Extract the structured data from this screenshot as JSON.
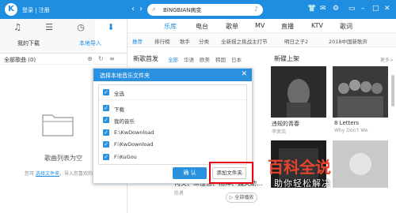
{
  "topbar": {
    "login": "登录 | 注册",
    "search_text": "BINGBIAN病变"
  },
  "left": {
    "tab_download": "我的下载",
    "tab_local_import": "本地导入",
    "section_title": "全部歌曲 (0)",
    "empty_title": "歌曲列表为空",
    "hint_prefix": "您可",
    "hint_link": "选择文件夹",
    "hint_suffix": "，导入您喜欢的音乐"
  },
  "main": {
    "tabs": [
      {
        "label": "乐库",
        "active": true
      },
      {
        "label": "电台"
      },
      {
        "label": "歌单"
      },
      {
        "label": "MV"
      },
      {
        "label": "直播"
      },
      {
        "label": "KTV"
      },
      {
        "label": "歌词"
      }
    ],
    "subtabs": [
      "推荐",
      "排行榜",
      "歌手",
      "分类",
      "全新摇之挑战主打节",
      "明日之子2",
      "2018中国新歌声"
    ],
    "new_first": "新歌首发",
    "lang_tabs": [
      "全部",
      "华语",
      "欧美",
      "韩国",
      "日本"
    ],
    "new_online": "新碟上架",
    "more": "更多>",
    "albums": [
      {
        "title": "违规的青春",
        "artist": "李荣浩"
      },
      {
        "title": "8 Letters",
        "artist": "Why Don't We"
      }
    ],
    "bottom_title": "何笑、朱佳善、杨洋、魏天助…",
    "bottom_sub": "陈勇",
    "all_play": "全部播放"
  },
  "dialog": {
    "title": "选择本地音乐文件夹",
    "select_all": "全选",
    "folders": [
      "下载",
      "我的音乐",
      "E:\\KwDownload",
      "F:\\KwDownload",
      "F:\\KuGou"
    ],
    "confirm": "确 认",
    "add_folder": "添加文件夹"
  },
  "watermark": {
    "big": "百科全说",
    "small": "助你轻松解决"
  },
  "colors": {
    "accent": "#1f8ee0",
    "highlight_box": "#e60012"
  }
}
